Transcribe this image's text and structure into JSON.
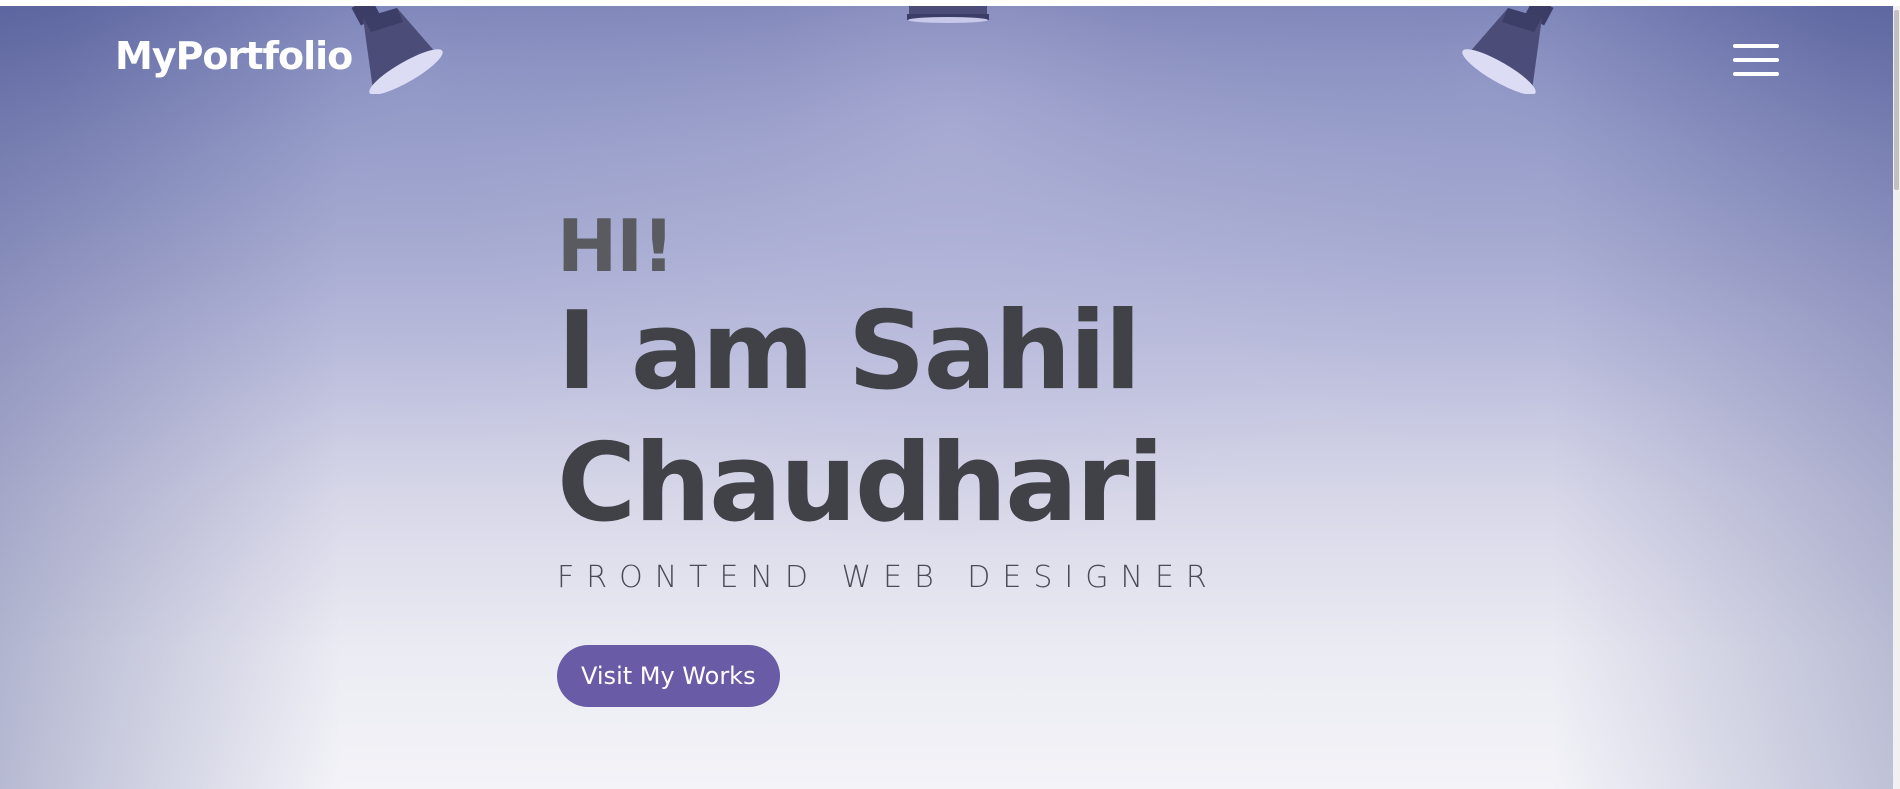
{
  "header": {
    "logo_text": "MyPortfolio",
    "menu_icon": "hamburger-menu-icon"
  },
  "hero": {
    "greeting": "HI!",
    "name_line_1": "I am Sahil",
    "name_line_2": "Chaudhari",
    "role": "FRONTEND WEB DESIGNER",
    "cta_label": "Visit My Works"
  },
  "decor": {
    "lamp_icon": "spotlight-icon"
  },
  "colors": {
    "cta_background": "#6a5ba6",
    "heading_text": "#404248",
    "greeting_text": "#5a5b60",
    "header_text": "#ffffff"
  }
}
